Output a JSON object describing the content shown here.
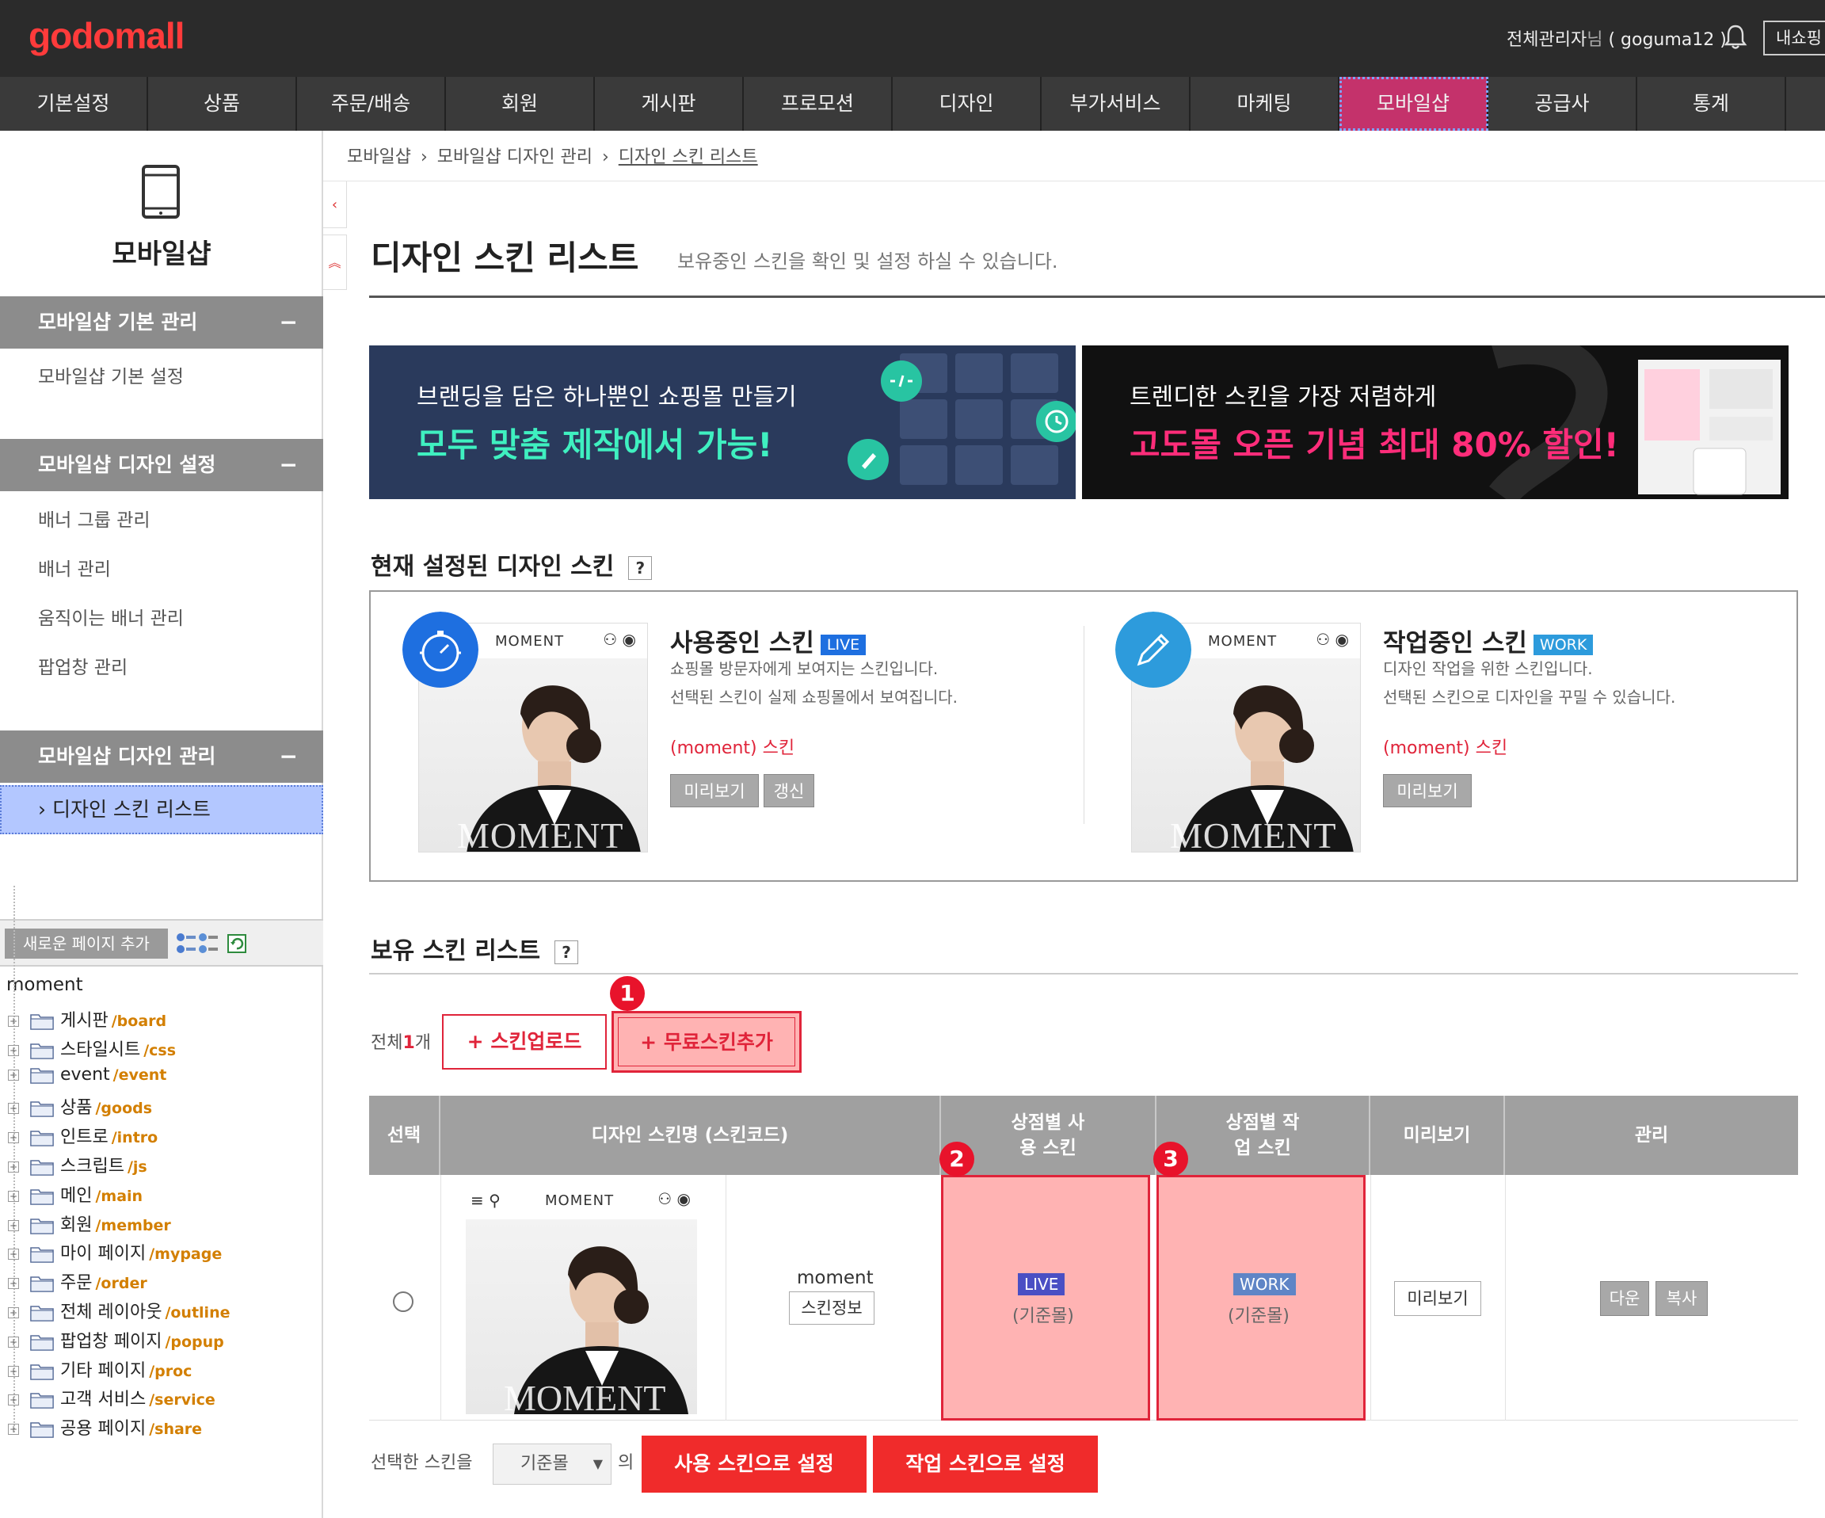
{
  "header": {
    "logo": "godomall",
    "admin_role": "전체관리자",
    "admin_suffix": "님",
    "admin_id": "( goguma12 )",
    "myshop_label": "내쇼핑"
  },
  "nav": {
    "items": [
      "기본설정",
      "상품",
      "주문/배송",
      "회원",
      "게시판",
      "프로모션",
      "디자인",
      "부가서비스",
      "마케팅",
      "모바일샵",
      "공급사",
      "통계"
    ],
    "active_index": 9,
    "active_color": "#c4326b"
  },
  "sidebar": {
    "title": "모바일샵",
    "sections": [
      {
        "title": "모바일샵 기본 관리",
        "items": [
          "모바일샵 기본 설정"
        ]
      },
      {
        "title": "모바일샵 디자인 설정",
        "items": [
          "배너 그룹 관리",
          "배너 관리",
          "움직이는 배너 관리",
          "팝업창 관리"
        ]
      },
      {
        "title": "모바일샵 디자인 관리",
        "items": [
          "디자인 스킨 리스트"
        ]
      }
    ],
    "collapse_symbol": "−",
    "new_page_label": "새로운 페이지 추가",
    "tree_root": "moment",
    "tree": [
      {
        "name": "게시판",
        "path": "/board"
      },
      {
        "name": "스타일시트",
        "path": "/css"
      },
      {
        "name": "event",
        "path": "/event"
      },
      {
        "name": "상품",
        "path": "/goods"
      },
      {
        "name": "인트로",
        "path": "/intro"
      },
      {
        "name": "스크립트",
        "path": "/js"
      },
      {
        "name": "메인",
        "path": "/main"
      },
      {
        "name": "회원",
        "path": "/member"
      },
      {
        "name": "마이 페이지",
        "path": "/mypage"
      },
      {
        "name": "주문",
        "path": "/order"
      },
      {
        "name": "전체 레이아웃",
        "path": "/outline"
      },
      {
        "name": "팝업창 페이지",
        "path": "/popup"
      },
      {
        "name": "기타 페이지",
        "path": "/proc"
      },
      {
        "name": "고객 서비스",
        "path": "/service"
      },
      {
        "name": "공용 페이지",
        "path": "/share"
      }
    ]
  },
  "breadcrumb": [
    "모바일샵",
    "모바일샵 디자인 관리",
    "디자인 스킨 리스트"
  ],
  "page": {
    "title": "디자인 스킨 리스트",
    "description": "보유중인 스킨을 확인 및 설정 하실 수 있습니다."
  },
  "banners": [
    {
      "line1": "브랜딩을 담은 하나뿐인 쇼핑몰 만들기",
      "line2": "모두 맞춤 제작에서 가능!"
    },
    {
      "line1": "트렌디한 스킨을 가장 저렴하게",
      "line2": "고도몰 오픈 기념 최대 80% 할인!"
    }
  ],
  "current_skin": {
    "section_title": "현재 설정된 디자인 스킨",
    "help": "?",
    "thumb_brand": "MOMENT",
    "thumb_watermark": "MOMENT",
    "live": {
      "title": "사용중인 스킨",
      "tag": "LIVE",
      "desc1": "쇼핑몰 방문자에게 보여지는 스킨입니다.",
      "desc2": "선택된 스킨이 실제 쇼핑몰에서 보여집니다.",
      "skin": "(moment) 스킨",
      "preview_label": "미리보기",
      "refresh_label": "갱신"
    },
    "work": {
      "title": "작업중인 스킨",
      "tag": "WORK",
      "desc1": "디자인 작업을 위한 스킨입니다.",
      "desc2": "선택된 스킨으로 디자인을 꾸밀 수 있습니다.",
      "skin": "(moment) 스킨",
      "preview_label": "미리보기"
    },
    "live_tag_color": "#1e6fe0",
    "work_tag_color": "#2d9bdc"
  },
  "owned": {
    "section_title": "보유 스킨 리스트",
    "help": "?",
    "total_prefix": "전체",
    "total_count": "1",
    "total_suffix": "개",
    "upload_label": "+ 스킨업로드",
    "free_label": "+ 무료스킨추가",
    "columns": [
      "선택",
      "디자인 스킨명 (스킨코드)",
      "상점별 사용 스킨",
      "상점별 작업 스킨",
      "미리보기",
      "관리"
    ],
    "row": {
      "thumb_brand": "MOMENT",
      "thumb_watermark": "MOMENT",
      "skin_name": "moment",
      "skin_info_label": "스킨정보",
      "live_tag": "LIVE",
      "live_sub": "(기준몰)",
      "work_tag": "WORK",
      "work_sub": "(기준몰)",
      "preview_label": "미리보기",
      "download_label": "다운",
      "copy_label": "복사"
    },
    "markers": [
      "1",
      "2",
      "3"
    ]
  },
  "footer_actions": {
    "label_before": "선택한 스킨을",
    "mall_select": "기준몰",
    "label_after": "의",
    "set_live_label": "사용 스킨으로 설정",
    "set_work_label": "작업 스킨으로 설정"
  }
}
